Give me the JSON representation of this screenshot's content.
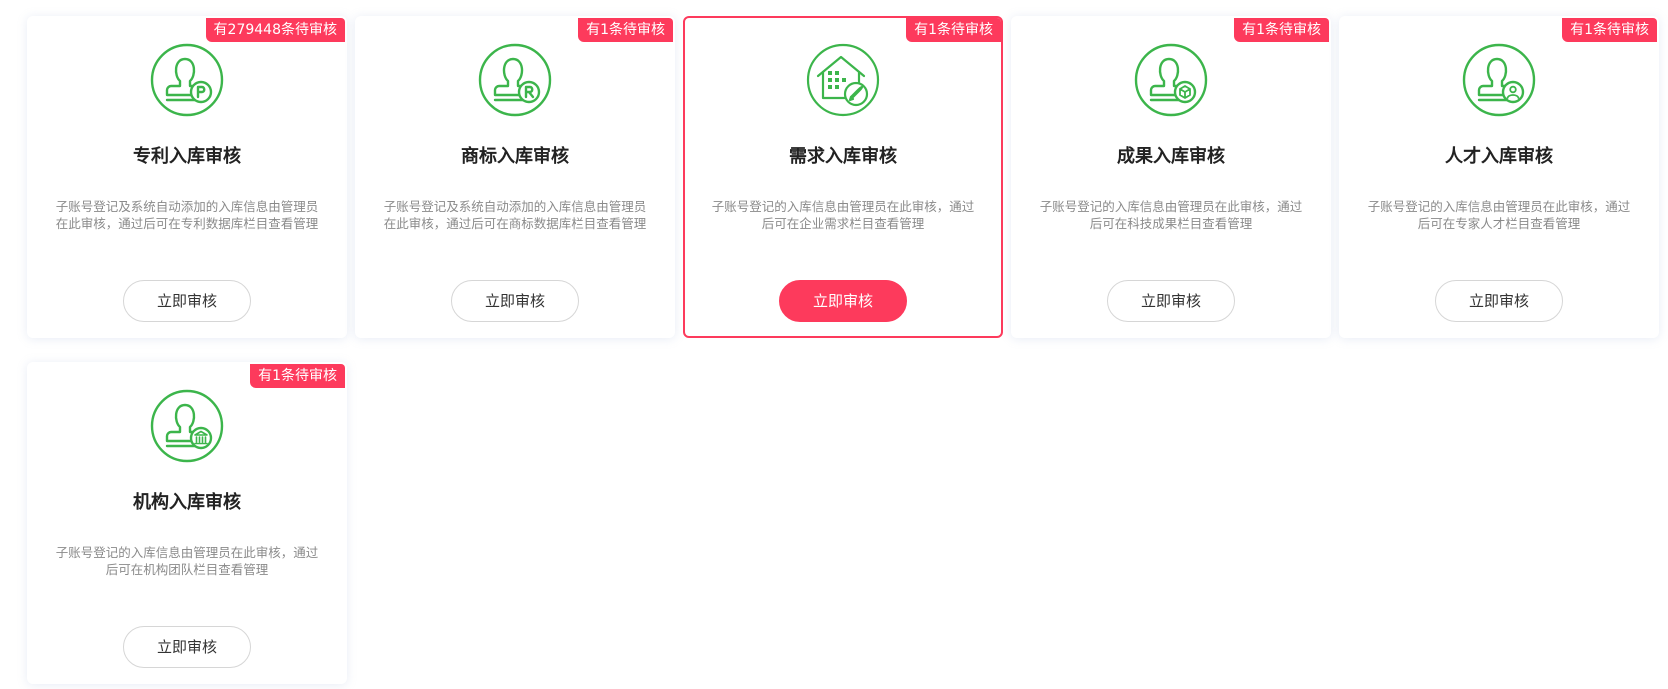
{
  "colors": {
    "accent": "#fd3a5c",
    "icon_green": "#3cb54b",
    "title": "#222222",
    "desc": "#8a8a8a"
  },
  "cards": [
    {
      "badge": "有279448条待审核",
      "title": "专利入库审核",
      "desc": "子账号登记及系统自动添加的入库信息由管理员在此审核，通过后可在专利数据库栏目查看管理",
      "button": "立即审核",
      "icon": "stamp-p-icon"
    },
    {
      "badge": "有1条待审核",
      "title": "商标入库审核",
      "desc": "子账号登记及系统自动添加的入库信息由管理员在此审核，通过后可在商标数据库栏目查看管理",
      "button": "立即审核",
      "icon": "stamp-r-icon"
    },
    {
      "badge": "有1条待审核",
      "title": "需求入库审核",
      "desc": "子账号登记的入库信息由管理员在此审核，通过后可在企业需求栏目查看管理",
      "button": "立即审核",
      "icon": "house-rocket-icon"
    },
    {
      "badge": "有1条待审核",
      "title": "成果入库审核",
      "desc": "子账号登记的入库信息由管理员在此审核，通过后可在科技成果栏目查看管理",
      "button": "立即审核",
      "icon": "stamp-cube-icon"
    },
    {
      "badge": "有1条待审核",
      "title": "人才入库审核",
      "desc": "子账号登记的入库信息由管理员在此审核，通过后可在专家人才栏目查看管理",
      "button": "立即审核",
      "icon": "stamp-person-icon"
    },
    {
      "badge": "有1条待审核",
      "title": "机构入库审核",
      "desc": "子账号登记的入库信息由管理员在此审核，通过后可在机构团队栏目查看管理",
      "button": "立即审核",
      "icon": "stamp-bank-icon"
    }
  ]
}
